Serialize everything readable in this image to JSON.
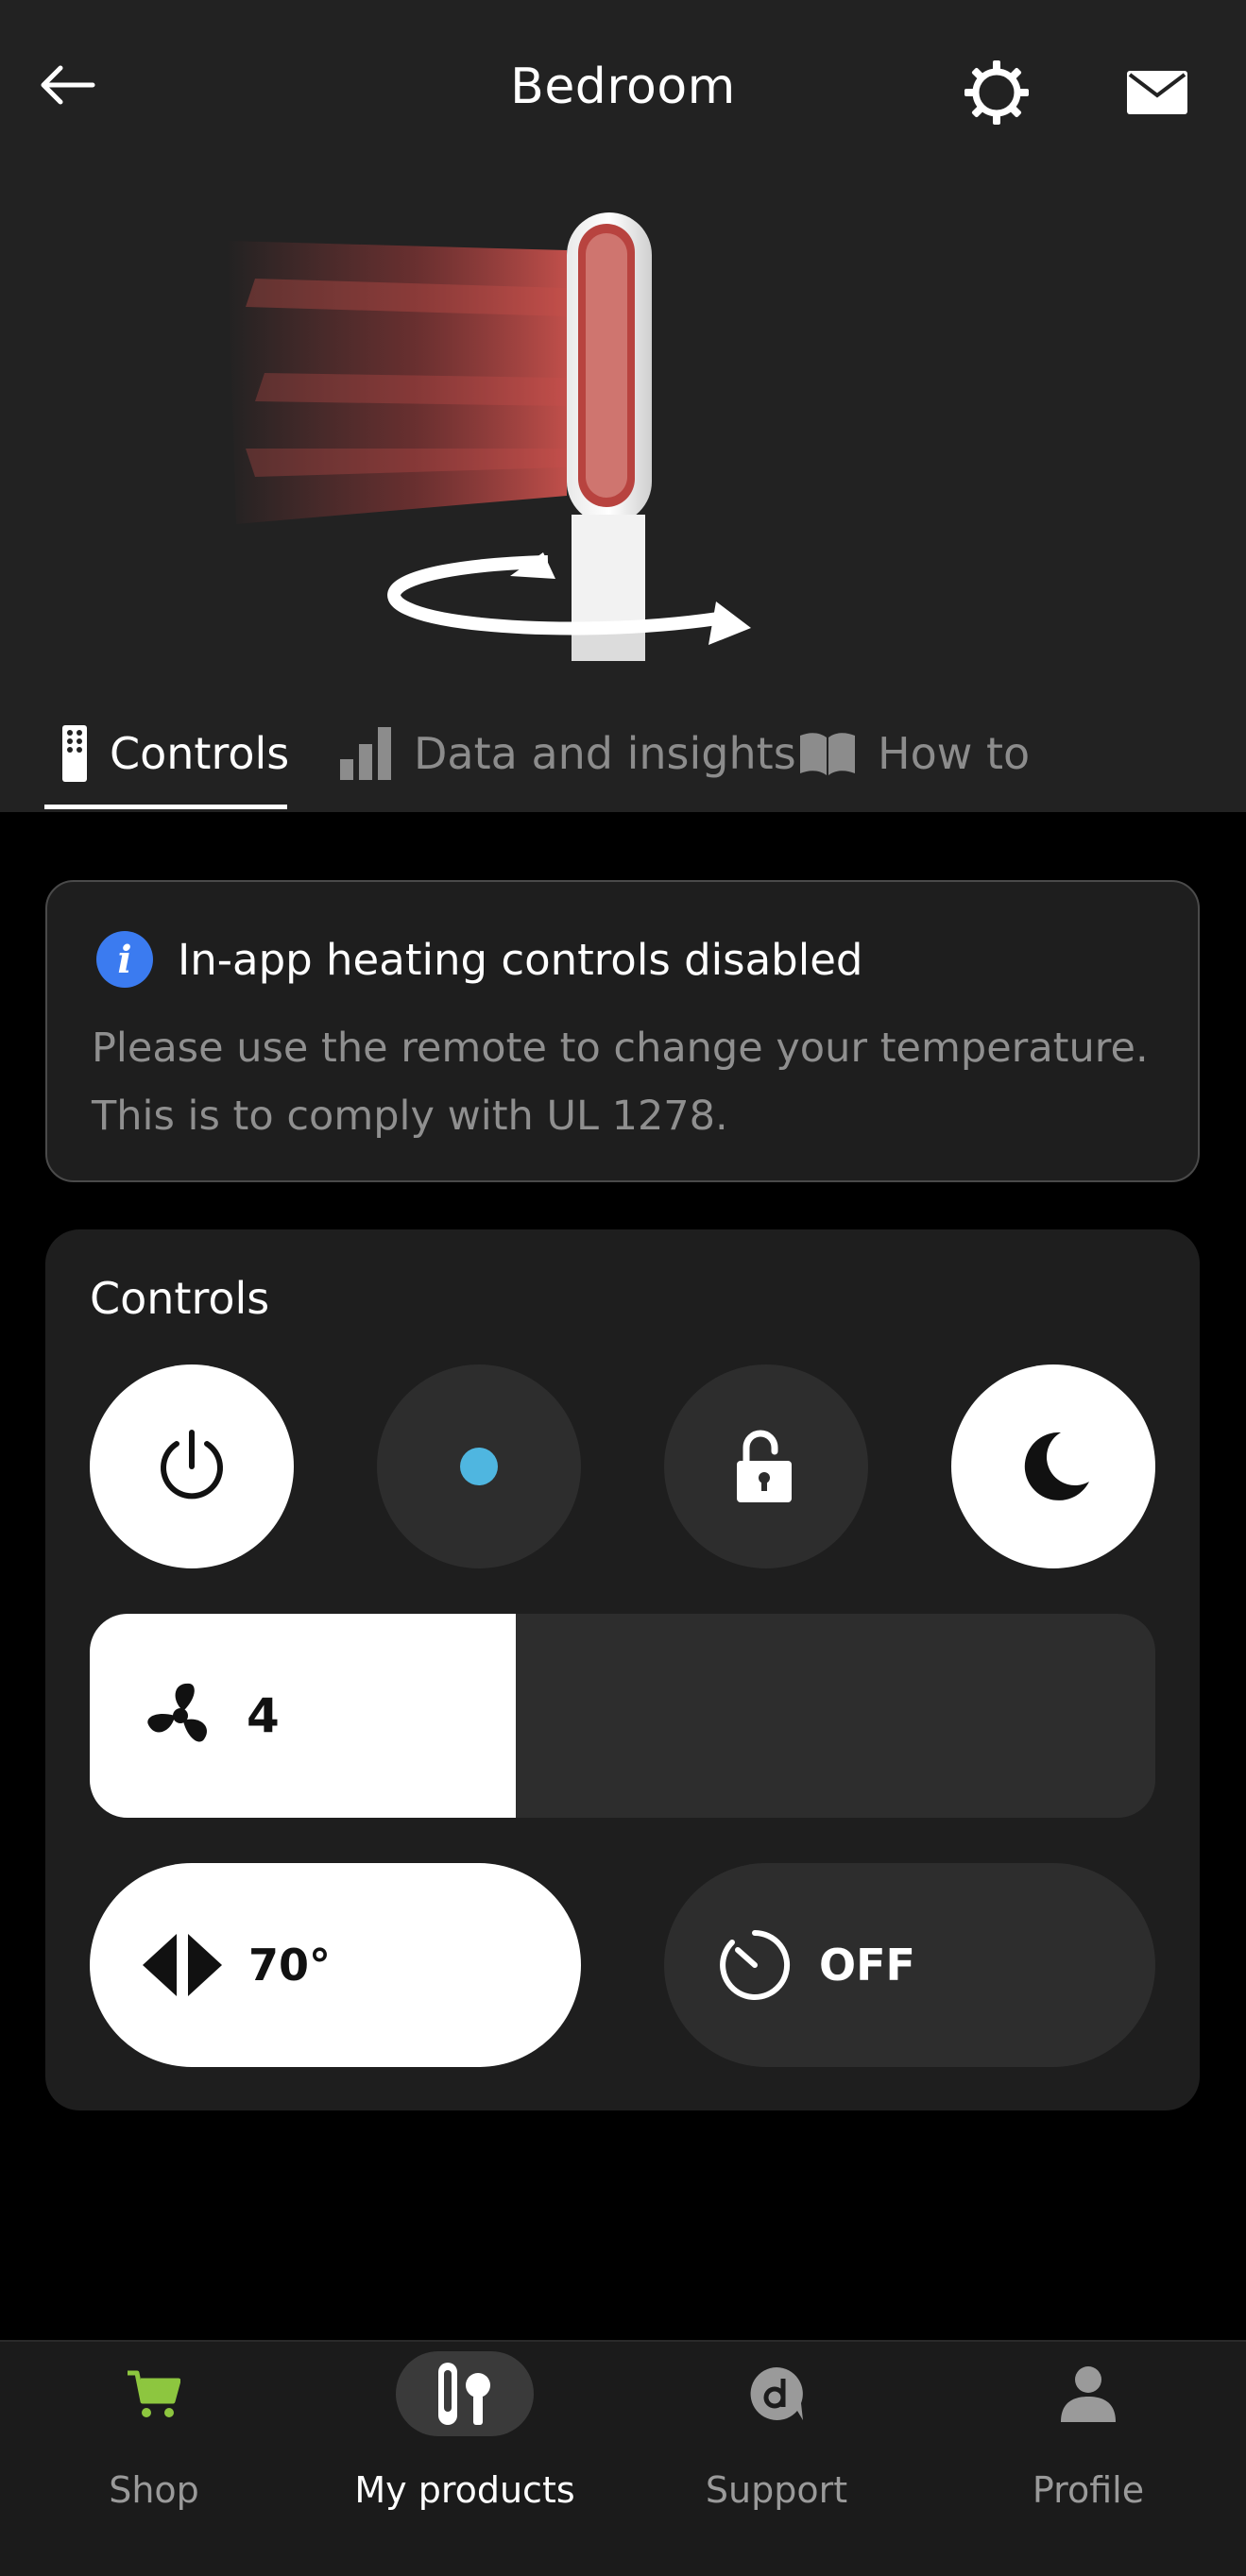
{
  "header": {
    "title": "Bedroom"
  },
  "tabs": [
    {
      "label": "Controls",
      "icon": "remote-icon",
      "active": true
    },
    {
      "label": "Data and insights",
      "icon": "bar-chart-icon",
      "active": false
    },
    {
      "label": "How to",
      "icon": "book-icon",
      "active": false
    }
  ],
  "notice": {
    "title": "In-app heating controls disabled",
    "body": "Please use the remote to change your temperature. This is to comply with UL 1278."
  },
  "controls": {
    "title": "Controls",
    "buttons": [
      {
        "icon": "power-icon",
        "state": "on"
      },
      {
        "icon": "dot-icon",
        "state": "off",
        "dot_color": "#4fb6e0"
      },
      {
        "icon": "unlock-icon",
        "state": "off"
      },
      {
        "icon": "moon-icon",
        "state": "on"
      }
    ],
    "fan_speed": {
      "value": "4",
      "level": 0.4
    },
    "oscillation": {
      "value": "70°"
    },
    "timer": {
      "value": "OFF"
    }
  },
  "colors": {
    "info_blue": "#3b7bf0",
    "shop_green": "#8dc63f",
    "header_bg": "#222222",
    "card_bg": "#1e1e1e"
  },
  "bottom_nav": [
    {
      "label": "Shop",
      "icon": "cart-icon",
      "active": false
    },
    {
      "label": "My products",
      "icon": "products-icon",
      "active": true
    },
    {
      "label": "Support",
      "icon": "support-icon",
      "active": false
    },
    {
      "label": "Profile",
      "icon": "profile-icon",
      "active": false
    }
  ]
}
